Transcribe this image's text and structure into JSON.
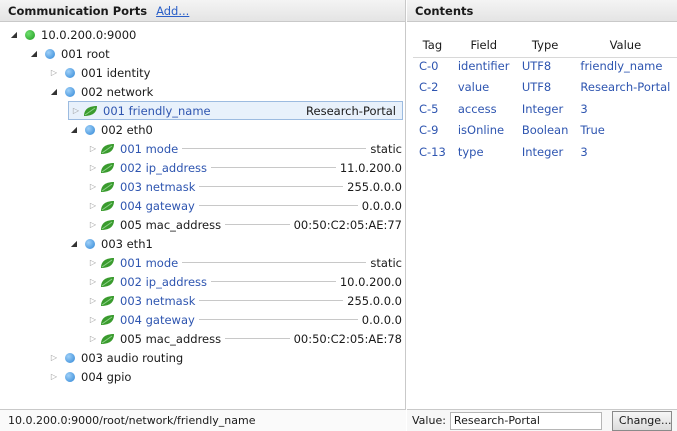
{
  "left_panel": {
    "title": "Communication Ports",
    "add_label": "Add..."
  },
  "tree": {
    "device": "10.0.200.0:9000",
    "root": {
      "index": "001",
      "label": "root"
    },
    "identity": {
      "index": "001",
      "label": "identity"
    },
    "network": {
      "index": "002",
      "label": "network"
    },
    "friendly_name": {
      "index": "001",
      "name": "friendly_name",
      "value": "Research-Portal"
    },
    "eth0": {
      "index": "002",
      "label": "eth0",
      "params": [
        {
          "index": "001",
          "name": "mode",
          "value": "static"
        },
        {
          "index": "002",
          "name": "ip_address",
          "value": "11.0.200.0"
        },
        {
          "index": "003",
          "name": "netmask",
          "value": "255.0.0.0"
        },
        {
          "index": "004",
          "name": "gateway",
          "value": "0.0.0.0"
        },
        {
          "index": "005",
          "name": "mac_address",
          "value": "00:50:C2:05:AE:77"
        }
      ]
    },
    "eth1": {
      "index": "003",
      "label": "eth1",
      "params": [
        {
          "index": "001",
          "name": "mode",
          "value": "static"
        },
        {
          "index": "002",
          "name": "ip_address",
          "value": "10.0.200.0"
        },
        {
          "index": "003",
          "name": "netmask",
          "value": "255.0.0.0"
        },
        {
          "index": "004",
          "name": "gateway",
          "value": "0.0.0.0"
        },
        {
          "index": "005",
          "name": "mac_address",
          "value": "00:50:C2:05:AE:78"
        }
      ]
    },
    "audio_routing": {
      "index": "003",
      "label": "audio routing"
    },
    "gpio": {
      "index": "004",
      "label": "gpio"
    }
  },
  "status_path": "10.0.200.0:9000/root/network/friendly_name",
  "contents": {
    "title": "Contents",
    "columns": [
      "Tag",
      "Field",
      "Type",
      "Value"
    ],
    "rows": [
      [
        "C-0",
        "identifier",
        "UTF8",
        "friendly_name"
      ],
      [
        "C-2",
        "value",
        "UTF8",
        "Research-Portal"
      ],
      [
        "C-5",
        "access",
        "Integer",
        "3"
      ],
      [
        "C-9",
        "isOnline",
        "Boolean",
        "True"
      ],
      [
        "C-13",
        "type",
        "Integer",
        "3"
      ]
    ]
  },
  "value_bar": {
    "label": "Value:",
    "value": "Research-Portal",
    "button": "Change..."
  },
  "colors": {
    "link": "#2a5fc8",
    "param": "#2e55b0",
    "online": "#2aa52a",
    "node": "#2f86d6",
    "leaf": "#3a9b2e"
  },
  "icons": {
    "device": "green-status-dot-icon",
    "node": "blue-node-dot-icon",
    "parameter": "green-leaf-icon"
  }
}
